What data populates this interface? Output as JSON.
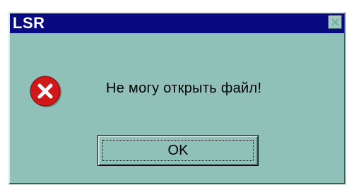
{
  "window": {
    "title": "LSR",
    "close_icon": "close-icon",
    "title_bar_color": "#0a0a80",
    "background_color": "#8fc1b8"
  },
  "dialog": {
    "icon": "error-icon",
    "icon_color": "#d01818",
    "message": "Не могу открыть файл!",
    "ok_label": "OK"
  }
}
